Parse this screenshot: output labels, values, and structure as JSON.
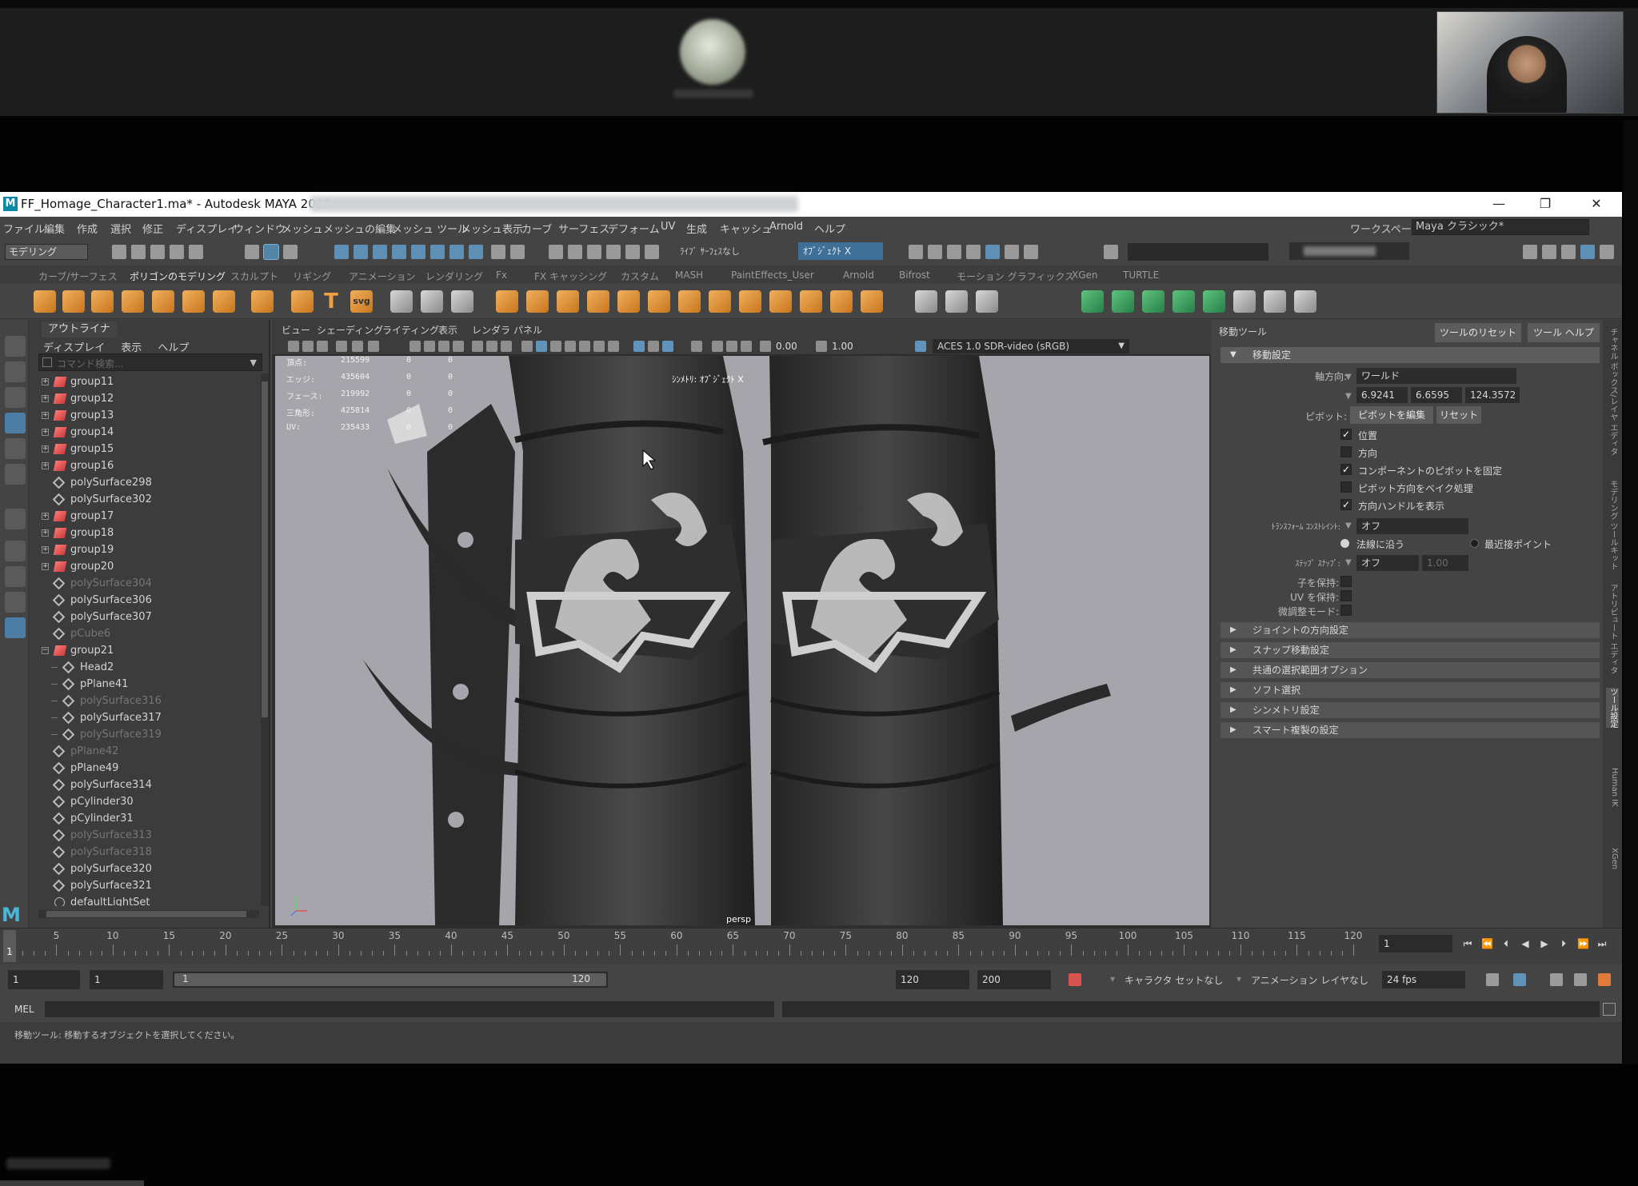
{
  "window": {
    "title": "FF_Homage_Character1.ma* - Autodesk MAYA 2022:",
    "minimize": "—",
    "restore": "❐",
    "close": "✕"
  },
  "menubar": {
    "items": [
      "ファイル",
      "編集",
      "作成",
      "選択",
      "修正",
      "ディスプレイ",
      "ウィンドウ",
      "メッシュ",
      "メッシュの編集",
      "メッシュ ツール",
      "メッシュ表示",
      "カーブ",
      "サーフェス",
      "デフォーム",
      "UV",
      "生成",
      "キャッシュ",
      "Arnold",
      "ヘルプ"
    ],
    "workspace_label": "ワークスペース:",
    "workspace_value": "Maya クラシック*"
  },
  "statusline": {
    "mode": "モデリング",
    "non_live": "ﾗｲﾌﾞ ｻｰﾌｪｽなし",
    "object_mode": "ｵﾌﾞｼﾞｪｸﾄ X"
  },
  "shelf": {
    "tabs": [
      "カーブ/サーフェス",
      "ポリゴンのモデリング",
      "スカルプト",
      "リギング",
      "アニメーション",
      "レンダリング",
      "Fx",
      "FX キャッシング",
      "カスタム",
      "MASH",
      "PaintEffects_User",
      "Arnold",
      "Bifrost",
      "モーション グラフィックス",
      "XGen",
      "TURTLE"
    ],
    "active_tab": "ポリゴンのモデリング",
    "text_icon": "T",
    "svg_icon": "svg"
  },
  "outliner": {
    "tab": "アウトライナ",
    "menu": [
      "ディスプレイ",
      "表示",
      "ヘルプ"
    ],
    "search_placeholder": "コマンド検索...",
    "rows": [
      {
        "label": "group11",
        "type": "group",
        "level": 0,
        "exp": "+",
        "dim": false
      },
      {
        "label": "group12",
        "type": "group",
        "level": 0,
        "exp": "+",
        "dim": false
      },
      {
        "label": "group13",
        "type": "group",
        "level": 0,
        "exp": "+",
        "dim": false
      },
      {
        "label": "group14",
        "type": "group",
        "level": 0,
        "exp": "+",
        "dim": false
      },
      {
        "label": "group15",
        "type": "group",
        "level": 0,
        "exp": "+",
        "dim": false
      },
      {
        "label": "group16",
        "type": "group",
        "level": 0,
        "exp": "+",
        "dim": false
      },
      {
        "label": "polySurface298",
        "type": "mesh",
        "level": 0,
        "exp": "",
        "dim": false
      },
      {
        "label": "polySurface302",
        "type": "mesh",
        "level": 0,
        "exp": "",
        "dim": false
      },
      {
        "label": "group17",
        "type": "group",
        "level": 0,
        "exp": "+",
        "dim": false
      },
      {
        "label": "group18",
        "type": "group",
        "level": 0,
        "exp": "+",
        "dim": false
      },
      {
        "label": "group19",
        "type": "group",
        "level": 0,
        "exp": "+",
        "dim": false
      },
      {
        "label": "group20",
        "type": "group",
        "level": 0,
        "exp": "+",
        "dim": false
      },
      {
        "label": "polySurface304",
        "type": "mesh",
        "level": 0,
        "exp": "",
        "dim": true
      },
      {
        "label": "polySurface306",
        "type": "mesh",
        "level": 0,
        "exp": "",
        "dim": false
      },
      {
        "label": "polySurface307",
        "type": "mesh",
        "level": 0,
        "exp": "",
        "dim": false
      },
      {
        "label": "pCube6",
        "type": "mesh",
        "level": 0,
        "exp": "",
        "dim": true
      },
      {
        "label": "group21",
        "type": "group",
        "level": 0,
        "exp": "−",
        "dim": false
      },
      {
        "label": "Head2",
        "type": "mesh",
        "level": 1,
        "exp": "",
        "dim": false
      },
      {
        "label": "pPlane41",
        "type": "mesh",
        "level": 1,
        "exp": "",
        "dim": false
      },
      {
        "label": "polySurface316",
        "type": "mesh",
        "level": 1,
        "exp": "",
        "dim": true
      },
      {
        "label": "polySurface317",
        "type": "mesh",
        "level": 1,
        "exp": "",
        "dim": false
      },
      {
        "label": "polySurface319",
        "type": "mesh",
        "level": 1,
        "exp": "",
        "dim": true
      },
      {
        "label": "pPlane42",
        "type": "mesh",
        "level": 0,
        "exp": "",
        "dim": true
      },
      {
        "label": "pPlane49",
        "type": "mesh",
        "level": 0,
        "exp": "",
        "dim": false
      },
      {
        "label": "polySurface314",
        "type": "mesh",
        "level": 0,
        "exp": "",
        "dim": false
      },
      {
        "label": "pCylinder30",
        "type": "mesh",
        "level": 0,
        "exp": "",
        "dim": false
      },
      {
        "label": "pCylinder31",
        "type": "mesh",
        "level": 0,
        "exp": "",
        "dim": false
      },
      {
        "label": "polySurface313",
        "type": "mesh",
        "level": 0,
        "exp": "",
        "dim": true
      },
      {
        "label": "polySurface318",
        "type": "mesh",
        "level": 0,
        "exp": "",
        "dim": true
      },
      {
        "label": "polySurface320",
        "type": "mesh",
        "level": 0,
        "exp": "",
        "dim": false
      },
      {
        "label": "polySurface321",
        "type": "mesh",
        "level": 0,
        "exp": "",
        "dim": false
      },
      {
        "label": "defaultLightSet",
        "type": "light",
        "level": 0,
        "exp": "",
        "dim": false
      }
    ]
  },
  "viewport": {
    "menu": [
      "ビュー",
      "シェーディング",
      "ライティング",
      "表示",
      "レンダラ",
      "パネル"
    ],
    "exposure": "0.00",
    "gamma": "1.00",
    "colorspace": "ACES 1.0 SDR-video (sRGB)",
    "hud": [
      {
        "label": "頂点:",
        "a": "215599",
        "b": "0",
        "c": "0"
      },
      {
        "label": "エッジ:",
        "a": "435604",
        "b": "0",
        "c": "0"
      },
      {
        "label": "フェース:",
        "a": "219992",
        "b": "0",
        "c": "0"
      },
      {
        "label": "三角形:",
        "a": "425814",
        "b": "0",
        "c": "0"
      },
      {
        "label": "UV:",
        "a": "235433",
        "b": "0",
        "c": "0"
      }
    ],
    "symmetry_label": "ｼﾝﾒﾄﾘ: ｵﾌﾞｼﾞｪｸﾄ X",
    "camera": "persp"
  },
  "toolpanel": {
    "title": "移動ツール",
    "reset_button": "ツールのリセット",
    "help_button": "ツール ヘルプ",
    "section": "移動設定",
    "axis_label": "軸方向:",
    "axis_value": "ワールド",
    "xyz": [
      "6.9241",
      "6.6595",
      "124.3572"
    ],
    "pivot_label": "ピボット:",
    "pivot_edit": "ピボットを編集",
    "pivot_reset": "リセット",
    "checks": [
      {
        "label": "位置",
        "checked": "✓"
      },
      {
        "label": "方向",
        "checked": ""
      },
      {
        "label": "コンポーネントのピボットを固定",
        "checked": "✓"
      },
      {
        "label": "ピボット方向をベイク処理",
        "checked": ""
      },
      {
        "label": "方向ハンドルを表示",
        "checked": "✓"
      }
    ],
    "constraint_label": "ﾄﾗﾝｽﾌｫｰﾑ ｺﾝｽﾄﾚｲﾝﾄ:",
    "constraint_value": "オフ",
    "radio_a": "法線に沿う",
    "radio_b": "最近接ポイント",
    "step_label": "ｽﾃｯﾌﾟ ｽﾅｯﾌﾟ:",
    "step_value": "オフ",
    "step_amount": "1.00",
    "keep_children": "子を保持:",
    "keep_uv": "UV を保持:",
    "tweak_mode": "微調整モード:",
    "collapsed": [
      "ジョイントの方向設定",
      "スナップ移動設定",
      "共通の選択範囲オプション",
      "ソフト選択",
      "シンメトリ設定",
      "スマート複製の設定"
    ],
    "side_tabs": [
      "チャネル ボックス/レイヤ エディタ",
      "モデリング ツールキット",
      "アトリビュート エディタ",
      "ツール設定",
      "Human IK",
      "XGen"
    ],
    "active_side_tab": "ツール設定"
  },
  "timeline": {
    "current": "1",
    "ticks": [
      "5",
      "10",
      "15",
      "20",
      "25",
      "30",
      "35",
      "40",
      "45",
      "50",
      "55",
      "60",
      "65",
      "70",
      "75",
      "80",
      "85",
      "90",
      "95",
      "100",
      "105",
      "110",
      "115",
      "120"
    ],
    "frame_field": "1"
  },
  "range": {
    "start": "1",
    "inner_start": "1",
    "bar_start": "1",
    "bar_end": "120",
    "end": "120",
    "anim_end": "200",
    "character_set": "キャラクタ セットなし",
    "anim_layer": "アニメーション レイヤなし",
    "fps": "24 fps"
  },
  "cmd": {
    "mel": "MEL",
    "help": "移動ツール: 移動するオブジェクトを選択してください。"
  }
}
